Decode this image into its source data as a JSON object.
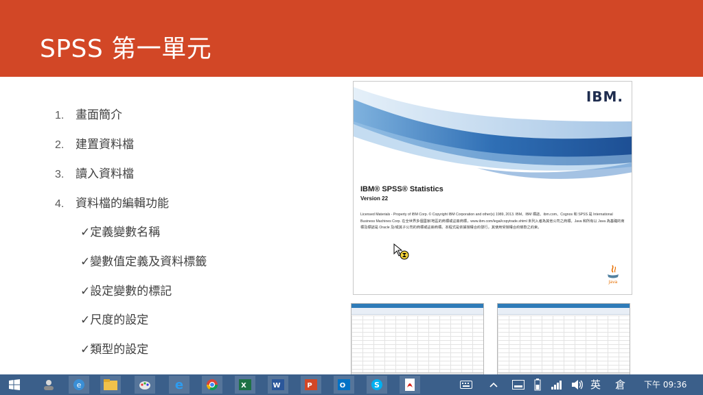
{
  "slide": {
    "title": "SPSS 第一單元",
    "outline": [
      {
        "num": "1.",
        "text": "畫面簡介"
      },
      {
        "num": "2.",
        "text": "建置資料檔"
      },
      {
        "num": "3.",
        "text": "讀入資料檔"
      },
      {
        "num": "4.",
        "text": "資料檔的編輯功能"
      }
    ],
    "subitems": [
      "✓定義變數名稱",
      "✓變數值定義及資料標籤",
      "✓設定變數的標記",
      "✓尺度的設定",
      "✓類型的設定"
    ]
  },
  "splash": {
    "logo": "IBM.",
    "product": "IBM® SPSS® Statistics",
    "version": "Version 22",
    "legal": "Licensed Materials - Property of IBM Corp. © Copyright IBM Corporation and other(s) 1989, 2013.  IBM、IBM 標誌、ibm.com、Cognos 和 SPSS 是 International Business Machines Corp. 在全世界多個國家/地區的商標或註冊商標，www.ibm.com/legal/copytrade.shtml 未列入者為其他公司之商標。Java 和所有以 Java 為基礎的商標及標誌是 Oracle 及/或其子公司的商標或註冊商標。本程式是依據授權合約發行，其使用受授權合約條款之約束。"
  },
  "colors": {
    "title_band": "#d24726",
    "taskbar": "#3b5f8a",
    "body_text": "#404040"
  },
  "taskbar": {
    "apps": [
      "windows-start-icon",
      "user-icon",
      "ie-icon",
      "file-explorer-icon",
      "paint-icon",
      "edge-icon",
      "chrome-icon",
      "excel-icon",
      "word-icon",
      "powerpoint-icon",
      "outlook-icon",
      "skype-icon",
      "pdf-icon"
    ],
    "ime": "英",
    "ime2": "倉",
    "clock": "下午 09:36"
  }
}
